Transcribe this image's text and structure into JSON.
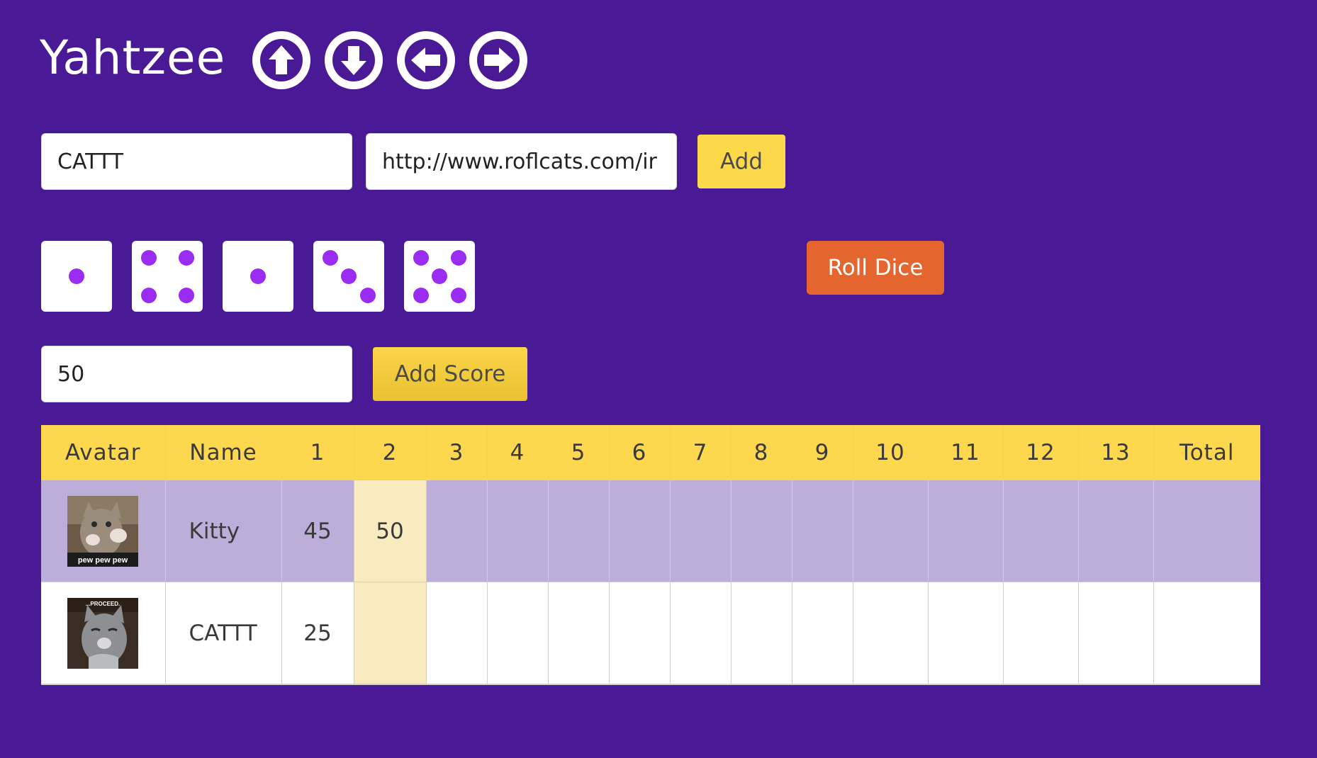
{
  "header": {
    "title": "Yahtzee",
    "nav_icons": [
      "arrow-up-icon",
      "arrow-down-icon",
      "arrow-left-icon",
      "arrow-right-icon"
    ]
  },
  "player_form": {
    "name_value": "CATTT",
    "avatar_url_value": "http://www.roflcats.com/ir",
    "add_label": "Add"
  },
  "dice": {
    "values": [
      1,
      4,
      1,
      3,
      5
    ],
    "roll_label": "Roll Dice",
    "pip_color": "#9a2cf2"
  },
  "score_form": {
    "score_value": "50",
    "add_score_label": "Add Score"
  },
  "table": {
    "headers": [
      "Avatar",
      "Name",
      "1",
      "2",
      "3",
      "4",
      "5",
      "6",
      "7",
      "8",
      "9",
      "10",
      "11",
      "12",
      "13",
      "Total"
    ],
    "current_column": "2",
    "rows": [
      {
        "name": "Kitty",
        "avatar_caption": "pew pew pew",
        "scores": [
          "45",
          "50",
          "",
          "",
          "",
          "",
          "",
          "",
          "",
          "",
          "",
          "",
          ""
        ],
        "total": "",
        "active": true
      },
      {
        "name": "CATTT",
        "avatar_caption": "...PROCEED.",
        "scores": [
          "25",
          "",
          "",
          "",
          "",
          "",
          "",
          "",
          "",
          "",
          "",
          "",
          ""
        ],
        "total": "",
        "active": false
      }
    ]
  },
  "colors": {
    "background": "#4a1a96",
    "header_row": "#fdd84e",
    "active_row": "#bcaed9",
    "current_column": "#f8ebbf",
    "roll_button": "#e5652f"
  }
}
